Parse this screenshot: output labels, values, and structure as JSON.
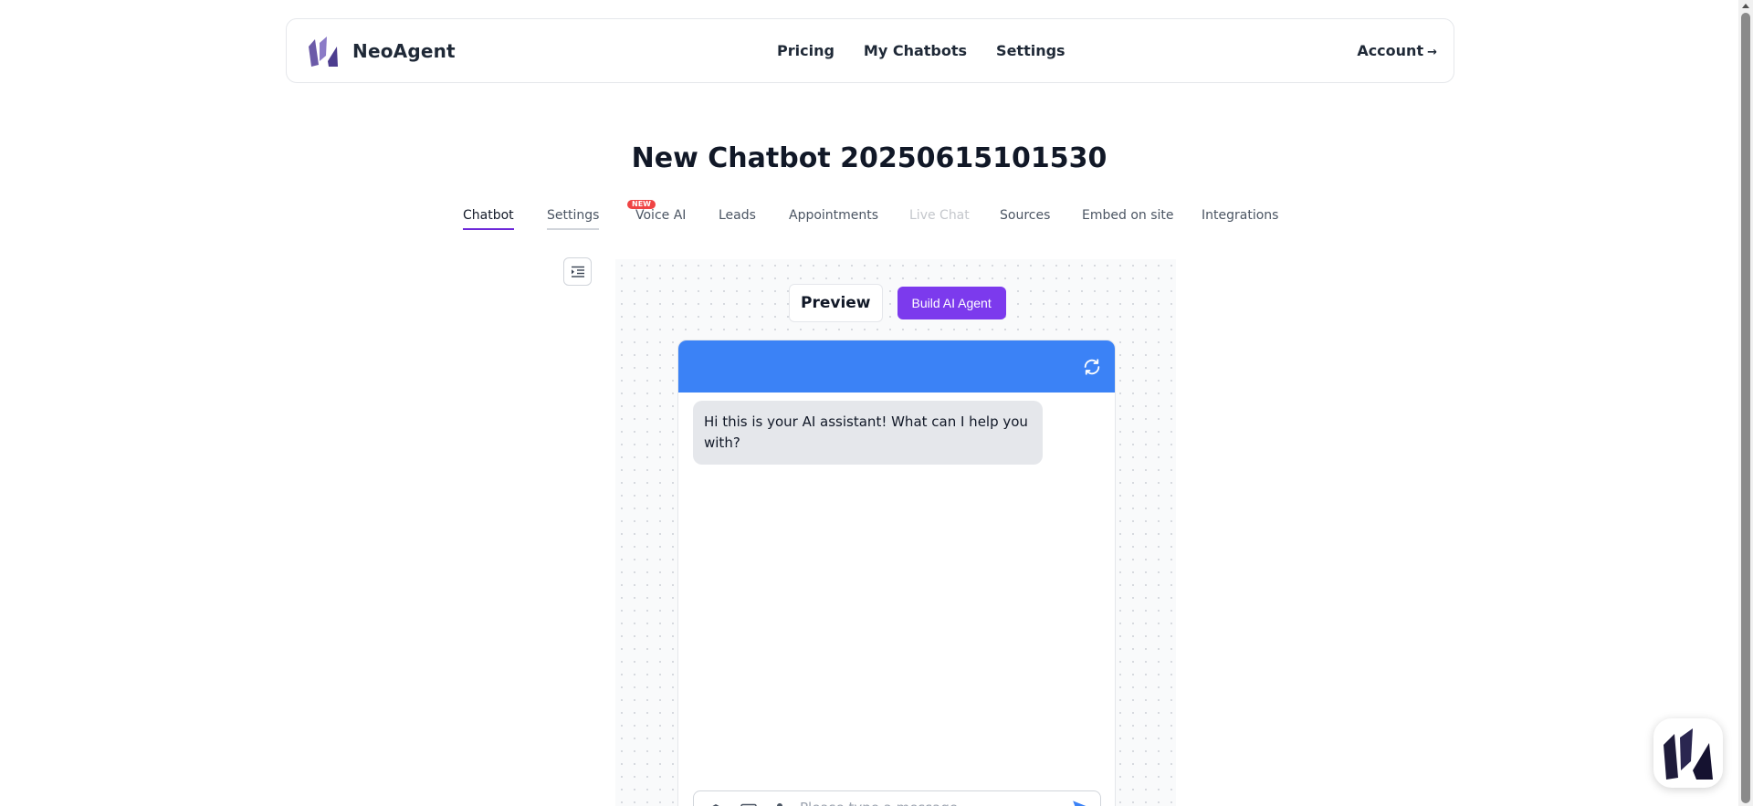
{
  "app": {
    "name": "NeoAgent"
  },
  "nav": {
    "pricing": "Pricing",
    "my_chatbots": "My Chatbots",
    "settings": "Settings",
    "account": "Account",
    "account_arrow": "→"
  },
  "page": {
    "title": "New Chatbot 20250615101530"
  },
  "tabs": [
    {
      "label": "Chatbot",
      "state": "active"
    },
    {
      "label": "Settings",
      "state": "normal"
    },
    {
      "label": "Voice AI",
      "state": "normal",
      "badge": "NEW"
    },
    {
      "label": "Leads",
      "state": "normal"
    },
    {
      "label": "Appointments",
      "state": "normal"
    },
    {
      "label": "Live Chat",
      "state": "disabled"
    },
    {
      "label": "Sources",
      "state": "normal"
    },
    {
      "label": "Embed on site",
      "state": "normal"
    },
    {
      "label": "Integrations",
      "state": "normal"
    }
  ],
  "toolbar": {
    "preview_label": "Preview",
    "build_label": "Build AI Agent"
  },
  "chat": {
    "header_color": "#3b82f6",
    "greeting": "Hi this is your AI assistant! What can I help you with?",
    "input_placeholder": "Please type a message"
  },
  "colors": {
    "accent": "#7c3aed",
    "chat_header": "#3b82f6",
    "badge": "#ef4444"
  },
  "icons": [
    "brand-logo-icon",
    "collapse-sidebar-icon",
    "refresh-icon",
    "layers-icon",
    "image-icon",
    "microphone-icon",
    "send-icon",
    "launcher-logo-icon"
  ]
}
